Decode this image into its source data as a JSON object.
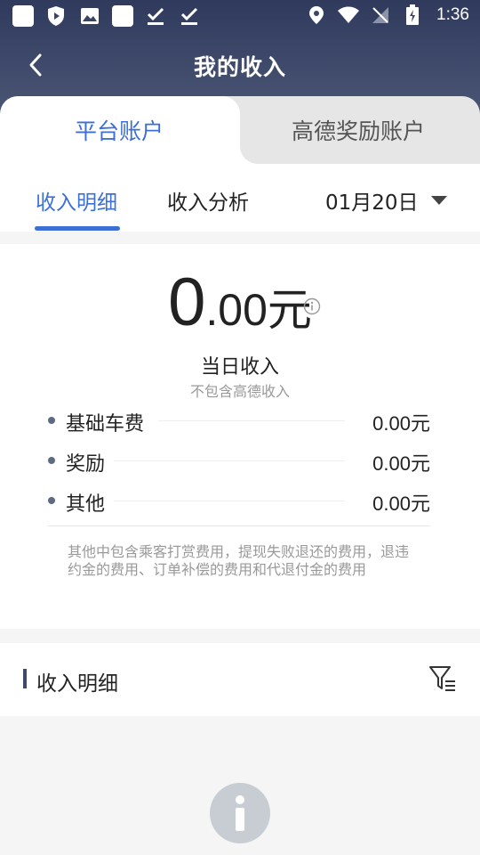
{
  "status_bar": {
    "time": "1:36"
  },
  "nav": {
    "title": "我的收入"
  },
  "account_tabs": {
    "platform": "平台账户",
    "reward": "高德奖励账户"
  },
  "sub_tabs": {
    "detail": "收入明细",
    "analysis": "收入分析",
    "date": "01月20日"
  },
  "income": {
    "amount_integer": "0",
    "amount_fraction": ".00元",
    "label": "当日收入",
    "sub_label": "不包含高德收入",
    "items": [
      {
        "name": "基础车费",
        "value": "0.00元"
      },
      {
        "name": "奖励",
        "value": "0.00元"
      },
      {
        "name": "其他",
        "value": "0.00元"
      }
    ],
    "note": "其他中包含乘客打赏费用，提现失败退还的费用，退违约金的费用、订单补偿的费用和代退付金的费用"
  },
  "detail_section": {
    "title": "收入明细"
  },
  "colors": {
    "accent": "#3d6fd6",
    "header": "#3f4a6b"
  }
}
